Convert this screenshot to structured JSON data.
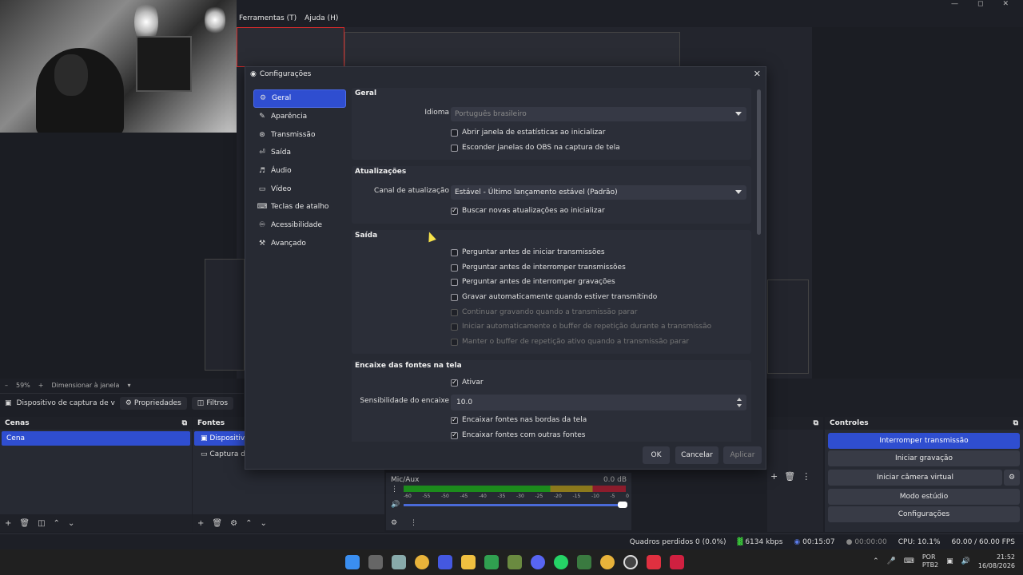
{
  "main_window": {
    "menu": [
      "Ferramentas (T)",
      "Ajuda (H)"
    ],
    "zoom": "59%",
    "zoom_mode": "Dimensionar à janela",
    "source_name": "Dispositivo de captura de v",
    "properties_label": "Propriedades",
    "filters_label": "Filtros"
  },
  "scenes": {
    "title": "Cenas",
    "items": [
      "Cena"
    ]
  },
  "sources": {
    "title": "Fontes",
    "items": [
      "Dispositivo",
      "Captura de"
    ]
  },
  "mixer": {
    "track": "Mic/Aux",
    "level": "0.0 dB",
    "ticks": [
      "-60",
      "-55",
      "-50",
      "-45",
      "-40",
      "-35",
      "-30",
      "-25",
      "-20",
      "-15",
      "-10",
      "-5",
      "0"
    ]
  },
  "controls": {
    "title": "Controles",
    "buttons": [
      "Interromper transmissão",
      "Iniciar gravação",
      "Iniciar câmera virtual",
      "Modo estúdio",
      "Configurações"
    ]
  },
  "status": {
    "dropped": "Quadros perdidos 0 (0.0%)",
    "bitrate": "6134 kbps",
    "stream_time": "00:15:07",
    "rec_time": "00:00:00",
    "cpu": "CPU: 10.1%",
    "fps": "60.00 / 60.00 FPS"
  },
  "taskbar": {
    "lang": "POR",
    "layout": "PTB2",
    "time": "21:52",
    "date": "16/08/2026"
  },
  "settings": {
    "title": "Configurações",
    "nav": [
      "Geral",
      "Aparência",
      "Transmissão",
      "Saída",
      "Áudio",
      "Vídeo",
      "Teclas de atalho",
      "Acessibilidade",
      "Avançado"
    ],
    "active_nav": "Geral",
    "groups": {
      "geral": {
        "title": "Geral",
        "language_label": "Idioma",
        "language_value": "Português brasileiro",
        "checks": [
          {
            "label": "Abrir janela de estatísticas ao inicializar",
            "checked": false
          },
          {
            "label": "Esconder janelas do OBS na captura de tela",
            "checked": false
          }
        ]
      },
      "updates": {
        "title": "Atualizações",
        "channel_label": "Canal de atualização",
        "channel_value": "Estável - Último lançamento estável (Padrão)",
        "checks": [
          {
            "label": "Buscar novas atualizações ao inicializar",
            "checked": true
          }
        ]
      },
      "output": {
        "title": "Saída",
        "checks": [
          {
            "label": "Perguntar antes de iniciar transmissões",
            "checked": false
          },
          {
            "label": "Perguntar antes de interromper transmissões",
            "checked": false
          },
          {
            "label": "Perguntar antes de interromper gravações",
            "checked": false
          },
          {
            "label": "Gravar automaticamente quando estiver transmitindo",
            "checked": false
          },
          {
            "label": "Continuar gravando quando a transmissão parar",
            "checked": false,
            "disabled": true
          },
          {
            "label": "Iniciar automaticamente o buffer de repetição durante a transmissão",
            "checked": false,
            "disabled": true
          },
          {
            "label": "Manter o buffer de repetição ativo quando a transmissão parar",
            "checked": false,
            "disabled": true
          }
        ]
      },
      "snapping": {
        "title": "Encaixe das fontes na tela",
        "enable_label": "Ativar",
        "sensitivity_label": "Sensibilidade do encaixe",
        "sensitivity_value": "10.0",
        "checks": [
          {
            "label": "Encaixar fontes nas bordas da tela",
            "checked": true
          },
          {
            "label": "Encaixar fontes com outras fontes",
            "checked": true
          }
        ]
      }
    },
    "buttons": {
      "ok": "OK",
      "cancel": "Cancelar",
      "apply": "Aplicar"
    }
  },
  "colors": {
    "accent": "#2f4ed0",
    "background": "#1d1f26",
    "panel": "#272a33"
  }
}
